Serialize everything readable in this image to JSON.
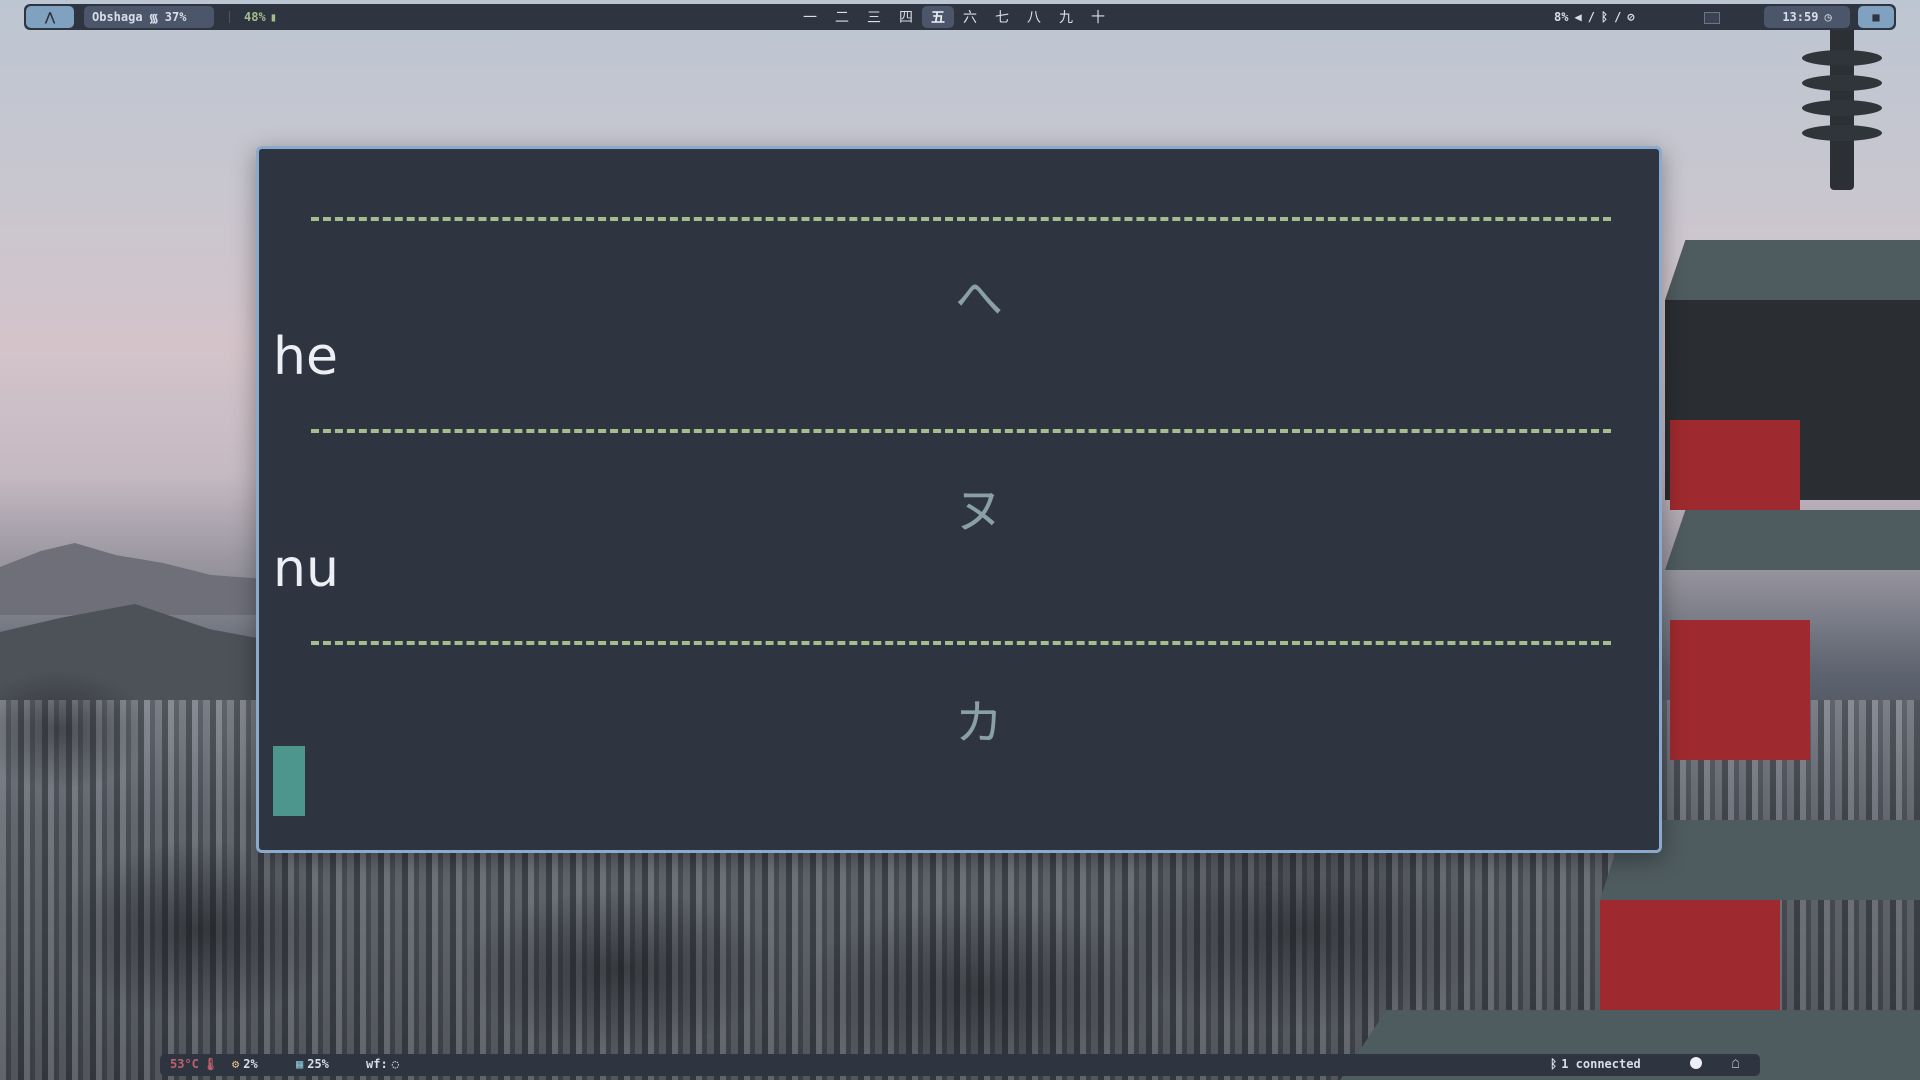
{
  "topbar": {
    "launcher_icon": "arch-icon",
    "network_name": "Obshaga",
    "wifi_strength": "37%",
    "battery": "48%",
    "workspaces": [
      "一",
      "二",
      "三",
      "四",
      "五",
      "六",
      "七",
      "八",
      "九",
      "十"
    ],
    "active_workspace": "五",
    "volume": "8%",
    "separator1": "/",
    "separator2": "/",
    "clock": "13:59"
  },
  "terminal": {
    "kana1": "へ",
    "romaji1": "he",
    "kana2": "ヌ",
    "romaji2": "nu",
    "kana3": "カ",
    "accent_color": "#a3be8c",
    "cursor_color": "#4c968e"
  },
  "bottombar": {
    "temperature": "53°C",
    "cpu": "2%",
    "memory": "25%",
    "wf_label": "wf:",
    "bluetooth_status": "1 connected"
  }
}
